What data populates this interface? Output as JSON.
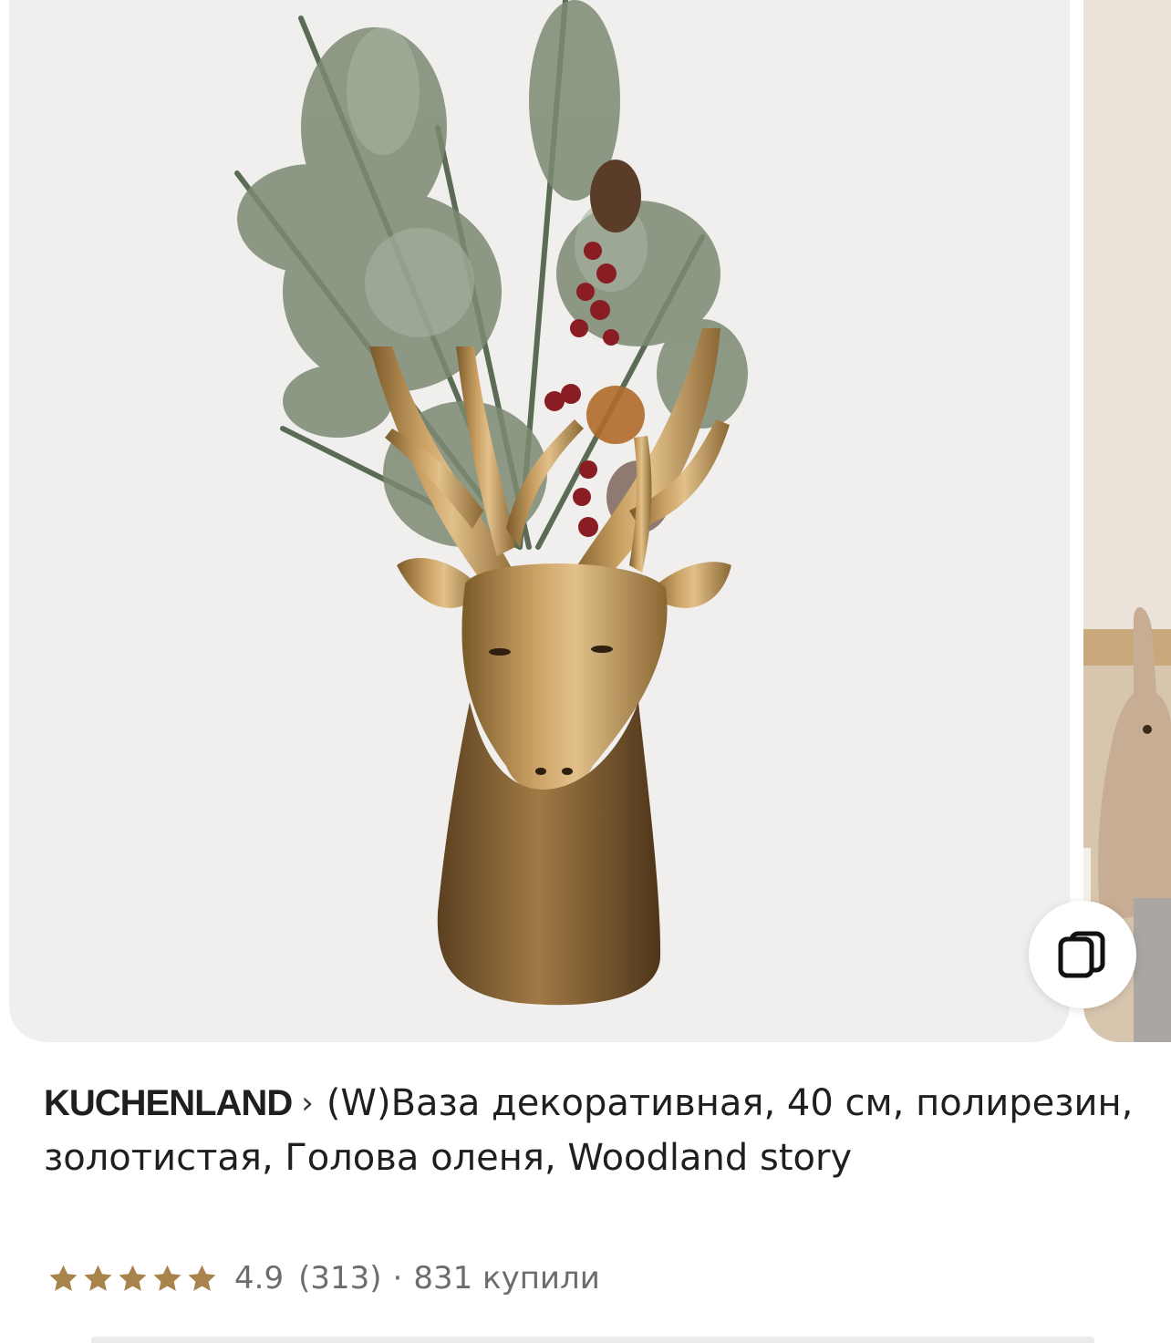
{
  "product": {
    "brand": "KUCHENLAND",
    "title": "(W)Ваза декоративная, 40 см, полирезин, золотистая, Голова оленя, Woodland story"
  },
  "rating": {
    "value": "4.9",
    "reviews": "(313)",
    "separator": "·",
    "purchases": "831 купили",
    "stars": 5,
    "star_color": "#a8834c"
  },
  "icons": {
    "brand_arrow": "chevron-right-icon",
    "fav": "cards-compare-icon"
  },
  "colors": {
    "card_bg": "#f0efed",
    "text": "#1f1f1f",
    "muted": "#6d6d6d"
  }
}
